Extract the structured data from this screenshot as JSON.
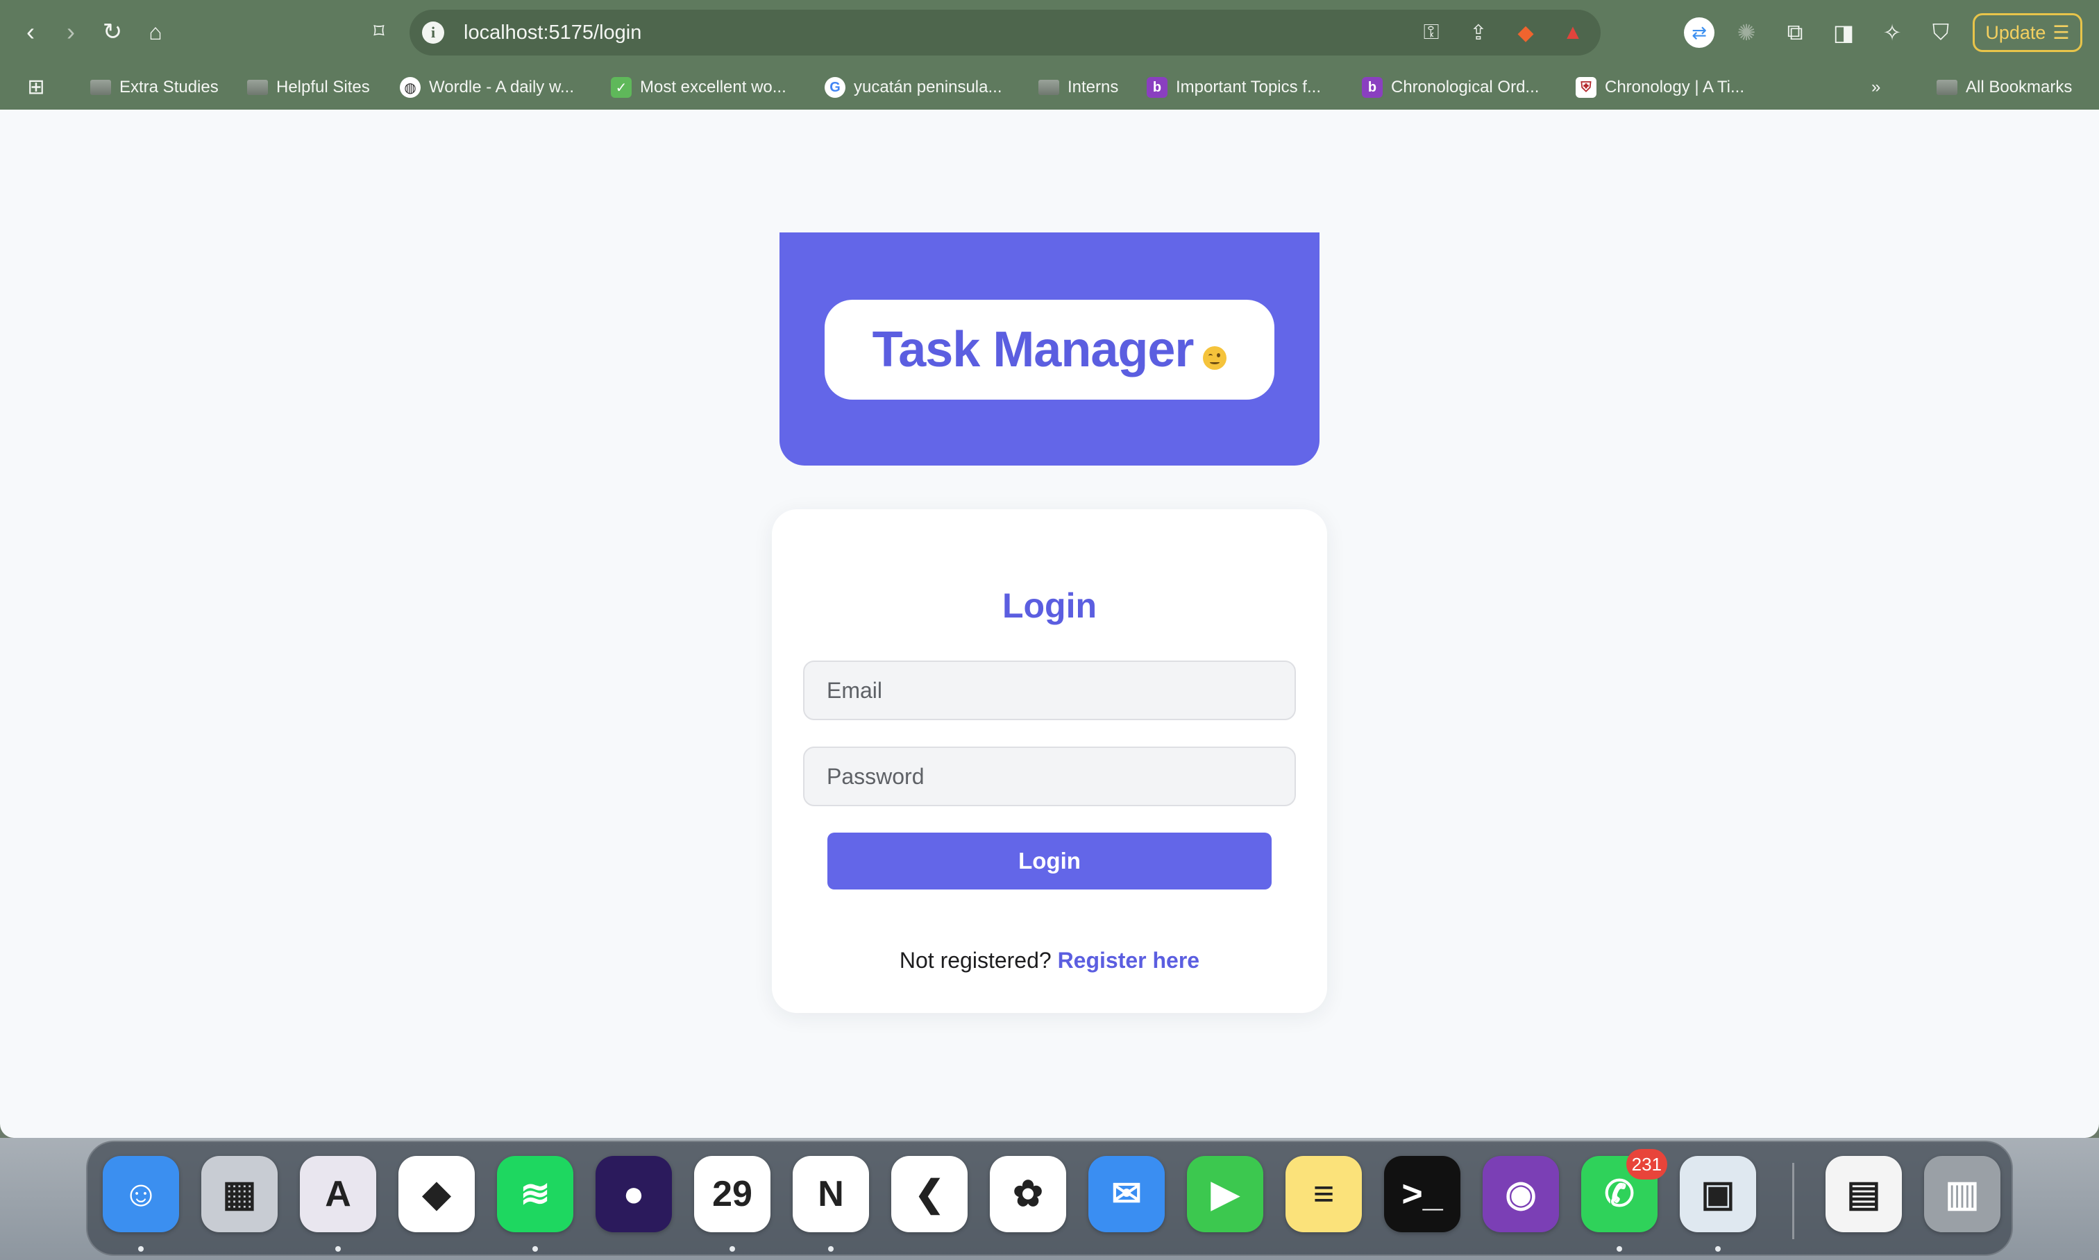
{
  "browser": {
    "url": "localhost:5175/login",
    "update_label": "Update",
    "bookmarks": [
      {
        "label": "Extra Studies",
        "kind": "folder"
      },
      {
        "label": "Helpful Sites",
        "kind": "folder"
      },
      {
        "label": "Wordle - A daily w...",
        "kind": "globe"
      },
      {
        "label": "Most excellent wo...",
        "kind": "check"
      },
      {
        "label": "yucatán peninsula...",
        "kind": "google"
      },
      {
        "label": "Interns",
        "kind": "folder"
      },
      {
        "label": "Important Topics f...",
        "kind": "b"
      },
      {
        "label": "Chronological Ord...",
        "kind": "b"
      },
      {
        "label": "Chronology | A Ti...",
        "kind": "shield"
      }
    ],
    "all_bookmarks_label": "All Bookmarks",
    "overflow_label": "»"
  },
  "app": {
    "title": "Task Manager",
    "login": {
      "heading": "Login",
      "email_placeholder": "Email",
      "password_placeholder": "Password",
      "submit_label": "Login",
      "register_prompt": "Not registered?",
      "register_link": "Register here"
    }
  },
  "dock": {
    "apps": [
      {
        "name": "finder-icon",
        "glyph": "☺",
        "bg": "#3b8ff0"
      },
      {
        "name": "launchpad-icon",
        "glyph": "▦",
        "bg": "#c8ccd3"
      },
      {
        "name": "arc-icon",
        "glyph": "A",
        "bg": "#e9e6ef"
      },
      {
        "name": "brave-icon",
        "glyph": "◆",
        "bg": "#ffffff"
      },
      {
        "name": "spotify-icon",
        "glyph": "≋",
        "bg": "#1ed760"
      },
      {
        "name": "firefox-icon",
        "glyph": "●",
        "bg": "#2b1a5c"
      },
      {
        "name": "calendar-icon",
        "glyph": "29",
        "bg": "#ffffff"
      },
      {
        "name": "notion-icon",
        "glyph": "N",
        "bg": "#ffffff"
      },
      {
        "name": "vscode-icon",
        "glyph": "❮",
        "bg": "#ffffff"
      },
      {
        "name": "photos-icon",
        "glyph": "✿",
        "bg": "#ffffff"
      },
      {
        "name": "mail-icon",
        "glyph": "✉",
        "bg": "#3a8ef2"
      },
      {
        "name": "facetime-icon",
        "glyph": "▶",
        "bg": "#3cc84f"
      },
      {
        "name": "notes-icon",
        "glyph": "≡",
        "bg": "#fbe27a"
      },
      {
        "name": "terminal-icon",
        "glyph": ">_",
        "bg": "#111111"
      },
      {
        "name": "github-desktop-icon",
        "glyph": "◉",
        "bg": "#7b3fb5"
      },
      {
        "name": "whatsapp-icon",
        "glyph": "✆",
        "bg": "#2fd25a",
        "badge": "231"
      },
      {
        "name": "preview-icon",
        "glyph": "▣",
        "bg": "#dfe8f0"
      },
      {
        "name": "document-icon",
        "glyph": "▤",
        "bg": "#f4f4f4"
      },
      {
        "name": "trash-icon",
        "glyph": "▥",
        "bg": "#9aa0a6"
      }
    ]
  },
  "colors": {
    "brand": "#6366e8",
    "brand_text": "#5b5ee0",
    "page_bg": "#f7f9fb",
    "chrome_bg": "#5f7a5e"
  }
}
